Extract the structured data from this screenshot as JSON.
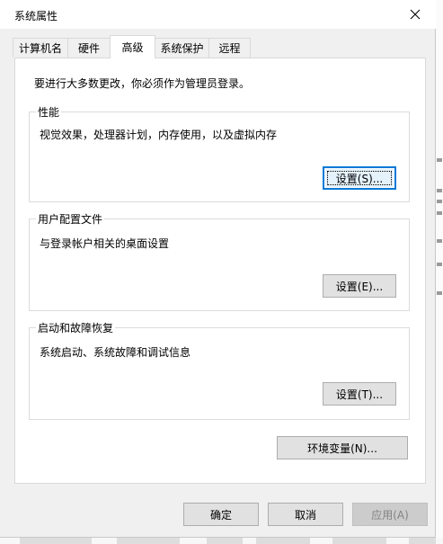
{
  "window": {
    "title": "系统属性"
  },
  "tabs": [
    {
      "label": "计算机名"
    },
    {
      "label": "硬件"
    },
    {
      "label": "高级"
    },
    {
      "label": "系统保护"
    },
    {
      "label": "远程"
    }
  ],
  "active_tab": "高级",
  "notice": "要进行大多数更改，你必须作为管理员登录。",
  "groups": {
    "performance": {
      "title": "性能",
      "description": "视觉效果，处理器计划，内存使用，以及虚拟内存",
      "button": "设置(S)..."
    },
    "user_profiles": {
      "title": "用户配置文件",
      "description": "与登录帐户相关的桌面设置",
      "button": "设置(E)..."
    },
    "startup_recovery": {
      "title": "启动和故障恢复",
      "description": "系统启动、系统故障和调试信息",
      "button": "设置(T)..."
    }
  },
  "env_button": "环境变量(N)...",
  "footer": {
    "ok": "确定",
    "cancel": "取消",
    "apply": "应用(A)"
  },
  "colors": {
    "accent": "#0078d7",
    "panel_bg": "#ffffff",
    "dialog_bg": "#f0f0f0",
    "disabled_text": "#838383"
  },
  "icons": {
    "close": "close-icon"
  }
}
